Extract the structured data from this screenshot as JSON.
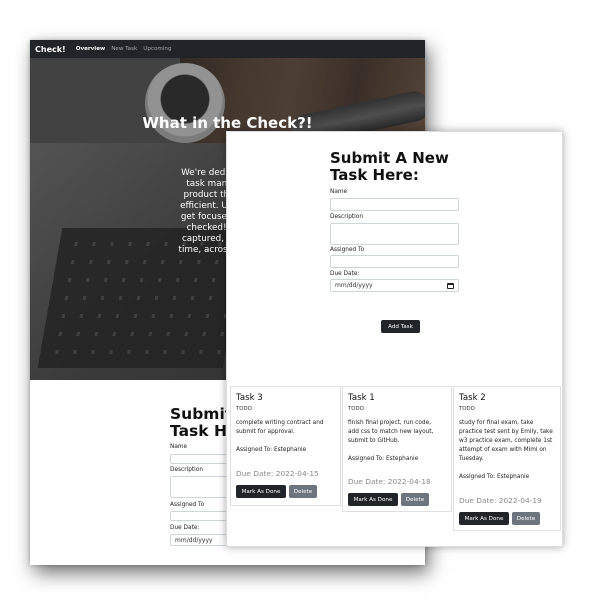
{
  "navbar": {
    "brand": "Check!",
    "links": [
      "Overview",
      "New Task",
      "Upcoming"
    ]
  },
  "hero": {
    "title": "What in the Check?!",
    "text_lines": [
      "We're dedicated to gi",
      "task manager! Our",
      "product that is depe",
      "efficient. Utilize this u",
      "get focused, get orga",
      "checked! Your task",
      "captured, and edited",
      "time, across any devic"
    ]
  },
  "back_form": {
    "title": "Submit A Task He",
    "labels": {
      "name": "Name",
      "description": "Description",
      "assigned_to": "Assigned To",
      "due_date": "Due Date:"
    },
    "due_date_placeholder": "mm/dd/yyyy"
  },
  "form": {
    "title": "Submit A New Task Here:",
    "labels": {
      "name": "Name",
      "description": "Description",
      "assigned_to": "Assigned To",
      "due_date": "Due Date:"
    },
    "due_date_placeholder": "mm/dd/yyyy",
    "submit_label": "Add Task"
  },
  "tasks": [
    {
      "title": "Task 3",
      "status": "TODO",
      "description_lines": [
        "complete writing contract and",
        "submit for approval."
      ],
      "assigned": "Assigned To: Estephanie",
      "due": "Due Date: 2022-04-15",
      "done_label": "Mark As Done",
      "delete_label": "Delete"
    },
    {
      "title": "Task 1",
      "status": "TODO",
      "description_lines": [
        "finish final project, run code,",
        "add css to match new layout,",
        "submit to GitHub."
      ],
      "assigned": "Assigned To: Estephanie",
      "due": "Due Date: 2022-04-18",
      "done_label": "Mark As Done",
      "delete_label": "Delete"
    },
    {
      "title": "Task 2",
      "status": "TODO",
      "description_lines": [
        "study for final exam, take",
        "practice test sent by Emily, take",
        "w3 practice exam, complete 1st",
        "attempt of exam with Mimi on",
        "Tuesday."
      ],
      "assigned": "Assigned To: Estephanie",
      "due": "Due Date: 2022-04-19",
      "done_label": "Mark As Done",
      "delete_label": "Delete"
    }
  ]
}
